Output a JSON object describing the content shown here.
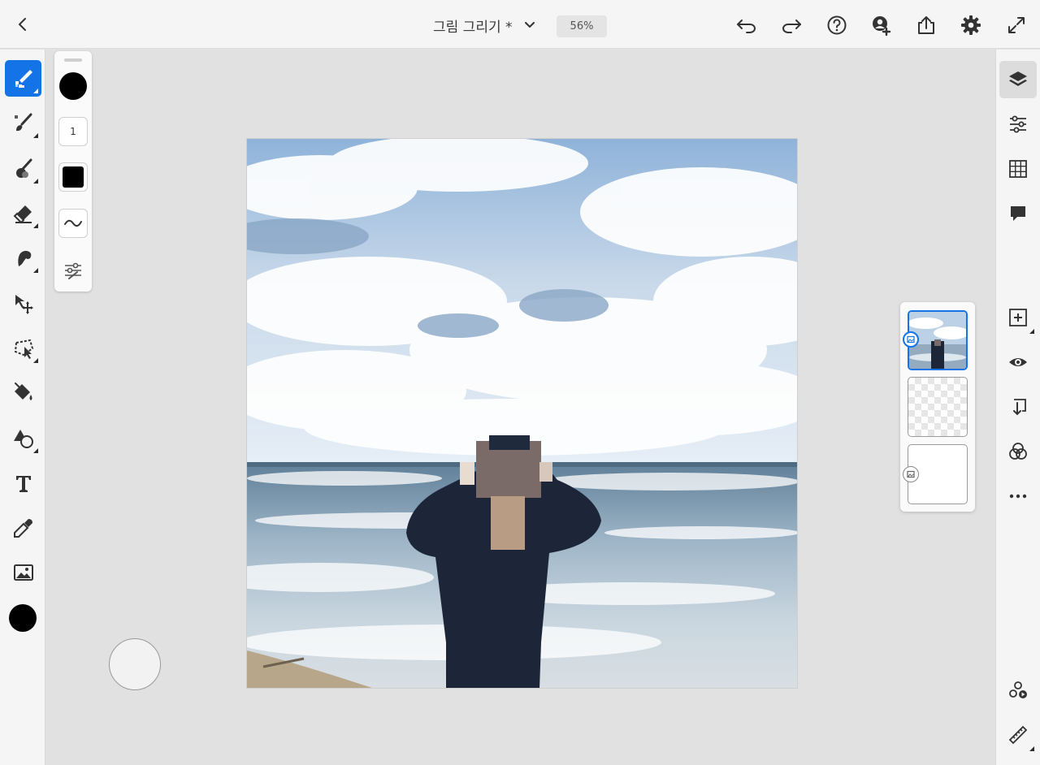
{
  "header": {
    "title": "그림 그리기 *",
    "zoom": "56%"
  },
  "brush_panel": {
    "opacity_value": "1"
  },
  "colors": {
    "accent": "#1473e6",
    "current_color": "#000000"
  },
  "left_tools": [
    "pixel-brush",
    "paint-brush",
    "mixer-brush",
    "eraser",
    "smudge",
    "move-transform",
    "lasso-selection",
    "fill",
    "shapes",
    "text",
    "eyedropper",
    "place-image"
  ],
  "right_tools": [
    "layers",
    "layer-properties",
    "grid",
    "comments",
    "add-layer",
    "visibility",
    "merge-down",
    "blend-mode",
    "more"
  ],
  "layers": [
    {
      "kind": "image",
      "selected": true
    },
    {
      "kind": "pixel",
      "selected": false
    },
    {
      "kind": "image",
      "selected": false
    }
  ]
}
